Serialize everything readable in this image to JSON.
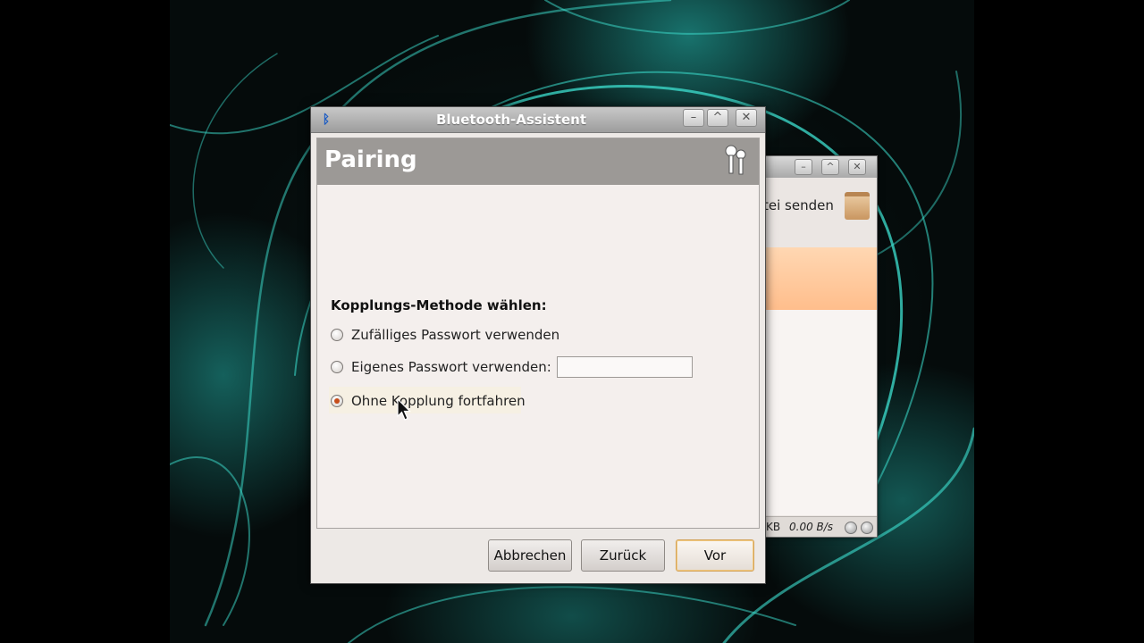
{
  "dialog": {
    "title": "Bluetooth-Assistent",
    "header": "Pairing",
    "icons": {
      "window": "bluetooth-icon",
      "header": "keys-icon"
    },
    "window_buttons": {
      "minimize": "–",
      "maximize": "^",
      "close": "✕"
    },
    "method_heading": "Kopplungs-Methode wählen:",
    "options": [
      {
        "label": "Zufälliges Passwort verwenden",
        "checked": false
      },
      {
        "label": "Eigenes Passwort verwenden:",
        "checked": false,
        "input_value": ""
      },
      {
        "label": "Ohne Kopplung fortfahren",
        "checked": true
      }
    ],
    "buttons": {
      "cancel": "Abbrechen",
      "back": "Zurück",
      "next": "Vor"
    }
  },
  "background_window": {
    "send_label": "tei senden",
    "status_kb": "KB",
    "status_rate": "0.00 B/s"
  },
  "colors": {
    "header_band": "#9c9996",
    "accent_radio": "#c64d1a",
    "highlight_row": "#ffbe8c"
  }
}
